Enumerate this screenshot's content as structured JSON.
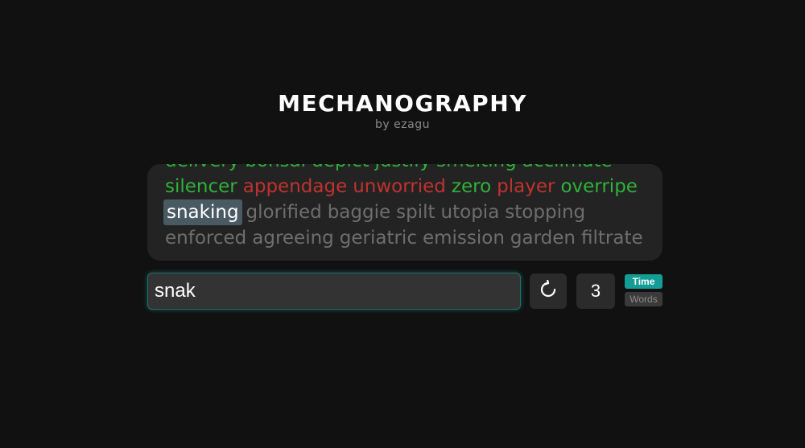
{
  "header": {
    "title": "MECHANOGRAPHY",
    "subtitle": "by ezagu"
  },
  "words": {
    "lines": [
      [
        {
          "text": "delivery",
          "state": "correct"
        },
        {
          "text": "bonsai",
          "state": "correct"
        },
        {
          "text": "depict",
          "state": "correct"
        },
        {
          "text": "justify",
          "state": "correct"
        },
        {
          "text": "smelting",
          "state": "correct"
        },
        {
          "text": "acclimate",
          "state": "correct"
        }
      ],
      [
        {
          "text": "silencer",
          "state": "correct"
        },
        {
          "text": "appendage",
          "state": "incorrect"
        },
        {
          "text": "unworried",
          "state": "incorrect"
        },
        {
          "text": "zero",
          "state": "correct"
        },
        {
          "text": "player",
          "state": "incorrect"
        },
        {
          "text": "overripe",
          "state": "correct"
        }
      ],
      [
        {
          "text": "snaking",
          "state": "current"
        },
        {
          "text": "glorified",
          "state": "pending"
        },
        {
          "text": "baggie",
          "state": "pending"
        },
        {
          "text": "spilt",
          "state": "pending"
        },
        {
          "text": "utopia",
          "state": "pending"
        },
        {
          "text": "stopping",
          "state": "pending"
        }
      ],
      [
        {
          "text": "enforced",
          "state": "pending"
        },
        {
          "text": "agreeing",
          "state": "pending"
        },
        {
          "text": "geriatric",
          "state": "pending"
        },
        {
          "text": "emission",
          "state": "pending"
        },
        {
          "text": "garden",
          "state": "pending"
        },
        {
          "text": "filtrate",
          "state": "pending"
        }
      ]
    ]
  },
  "input": {
    "value": "snak"
  },
  "controls": {
    "restart_icon": "restart-icon",
    "counter": "3",
    "mode_time": "Time",
    "mode_words": "Words",
    "active_mode": "Time"
  },
  "colors": {
    "correct": "#2fb13a",
    "incorrect": "#c0322f",
    "pending": "#6e6e6e",
    "accent": "#149c96"
  }
}
